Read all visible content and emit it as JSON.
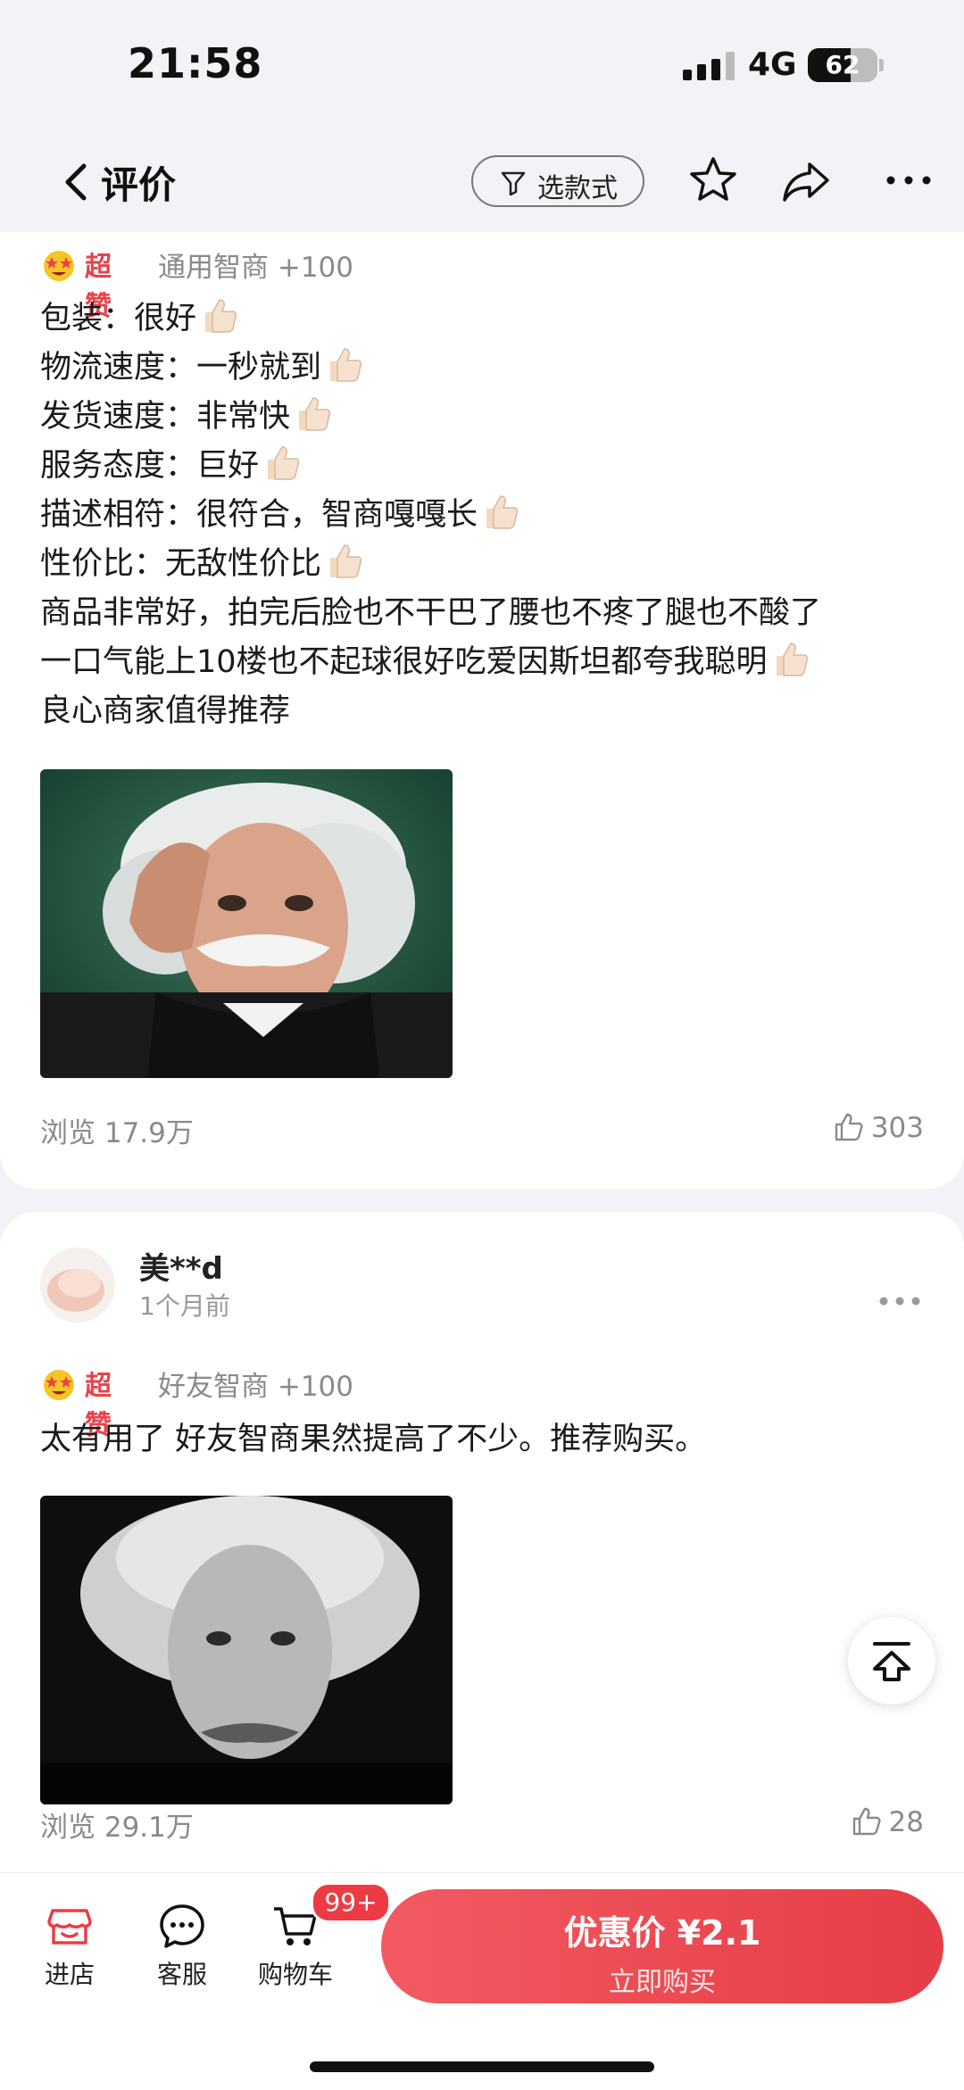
{
  "status_bar": {
    "time": "21:58",
    "network": "4G",
    "battery": "62"
  },
  "header": {
    "title": "评价",
    "filter_label": "选款式"
  },
  "reviews": [
    {
      "badge": "超赞",
      "meta": "通用智商 +100",
      "lines": [
        "包装：很好",
        "物流速度：一秒就到",
        "发货速度：非常快",
        "服务态度：巨好",
        "描述相符：很符合，智商嘎嘎长",
        "性价比：无敌性价比",
        "商品非常好，拍完后脸也不干巴了腰也不疼了腿也不酸了",
        "一口气能上10楼也不起球很好吃爱因斯坦都夸我聪明",
        "良心商家值得推荐"
      ],
      "views": "浏览 17.9万",
      "likes": "303"
    },
    {
      "user": "美**d",
      "time": "1个月前",
      "badge": "超赞",
      "meta": "好友智商 +100",
      "text": "太有用了 好友智商果然提高了不少。推荐购买。",
      "views": "浏览 29.1万",
      "likes": "28"
    }
  ],
  "bottom_bar": {
    "store": "进店",
    "service": "客服",
    "cart": "购物车",
    "cart_badge": "99+",
    "buy_price": "优惠价 ¥2.1",
    "buy_label": "立即购买"
  },
  "colors": {
    "accent": "#e8424b",
    "buy_button": "#ec4a52"
  }
}
